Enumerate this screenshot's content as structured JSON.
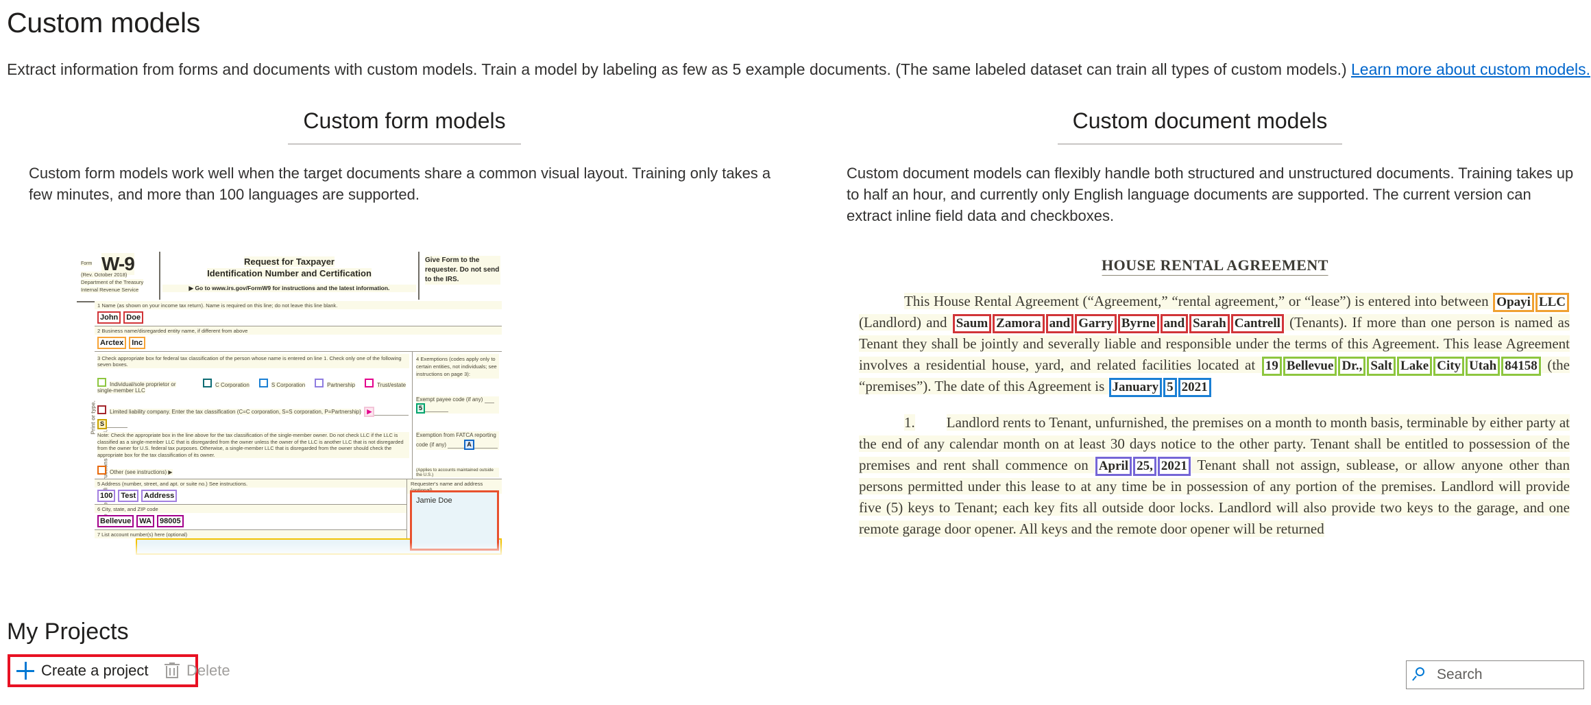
{
  "header": {
    "title": "Custom models",
    "description_before_link": "Extract information from forms and documents with custom models. Train a model by labeling as few as 5 example documents. (The same labeled dataset can train all types of custom models.) ",
    "link_text": "Learn more about custom models."
  },
  "columns": [
    {
      "heading": "Custom form models",
      "body": "Custom form models work well when the target documents share a common visual layout. Training only takes a few minutes, and more than 100 languages are supported."
    },
    {
      "heading": "Custom document models",
      "body": "Custom document models can flexibly handle both structured and unstructured documents. Training takes up to half an hour, and currently only English language documents are supported. The current version can extract inline field data and checkboxes."
    }
  ],
  "w9_form": {
    "form_label": "Form",
    "form_number": "W-9",
    "revision": "(Rev. October 2018)",
    "department": "Department of the Treasury",
    "agency": "Internal Revenue Service",
    "title_line1": "Request for Taxpayer",
    "title_line2": "Identification Number and Certification",
    "goto_line": "▶ Go to www.irs.gov/FormW9 for instructions and the latest information.",
    "give_form": "Give Form to the requester. Do not send to the IRS.",
    "rail_text_1": "Print or type.",
    "rail_text_2": "See Specific Instructions on page 3.",
    "line1_label": "1  Name (as shown on your income tax return). Name is required on this line; do not leave this line blank.",
    "line1_tokens": [
      "John",
      "Doe"
    ],
    "line2_label": "2  Business name/disregarded entity name, if different from above",
    "line2_tokens": [
      "Arctex",
      "Inc"
    ],
    "line3_label": "3  Check appropriate box for federal tax classification of the person whose name is entered on line 1. Check only one of the following seven boxes.",
    "checkboxes": [
      "Individual/sole proprietor or single-member LLC",
      "C Corporation",
      "S Corporation",
      "Partnership",
      "Trust/estate"
    ],
    "llc_line": "Limited liability company. Enter the tax classification (C=C corporation, S=S corporation, P=Partnership)",
    "llc_value": "S",
    "note_text": "Note: Check the appropriate box in the line above for the tax classification of the single-member owner.  Do not check LLC if the LLC is classified as a single-member LLC that is disregarded from the owner unless the owner of the LLC is another LLC that is not disregarded from the owner for U.S. federal tax purposes. Otherwise, a single-member LLC that is disregarded from the owner should check the appropriate box for the tax classification of its owner.",
    "other_line": "Other (see instructions) ▶",
    "line4_label": "4  Exemptions (codes apply only to certain entities, not individuals; see instructions on page 3):",
    "exempt_payee_label": "Exempt payee code (if any)",
    "exempt_payee_value": "5",
    "fatca_label": "Exemption from FATCA reporting code (if any)",
    "fatca_value": "A",
    "applies_note": "(Applies to accounts maintained outside the U.S.)",
    "line5_label": "5  Address (number, street, and apt. or suite no.) See instructions.",
    "line5_tokens": [
      "100",
      "Test",
      "Address"
    ],
    "line6_label": "6  City, state, and ZIP code",
    "line6_tokens": [
      "Bellevue",
      "WA",
      "98005"
    ],
    "line7_label": "7  List account number(s) here (optional)",
    "requester_label": "Requester's name and address (optional)",
    "requester_value": "Jamie Doe"
  },
  "rental_agreement": {
    "title": "HOUSE RENTAL AGREEMENT",
    "p1_part1": "This House Rental Agreement (“Agreement,” “rental agreement,” or “lease”) is entered into between ",
    "landlord_tokens": [
      "Opayi",
      "LLC"
    ],
    "p1_part2": " (Landlord) and ",
    "tenant_tokens": [
      "Saum",
      "Zamora",
      "and",
      "Garry",
      "Byrne",
      "and",
      "Sarah",
      "Cantrell"
    ],
    "p1_part3": " (Tenants).   If more than one person is named as Tenant they shall be jointly and severally liable and responsible under the terms of this Agreement.  This lease Agreement involves a residential house, yard, and related facilities located at ",
    "address_tokens": [
      "19",
      "Bellevue",
      "Dr.,",
      "Salt",
      "Lake",
      "City",
      "Utah",
      "84158"
    ],
    "p1_part4": " (the “premises”). The date of this Agreement is ",
    "date_tokens": [
      "January",
      "5",
      "2021"
    ],
    "p2_number": "1.",
    "p2_part1": "Landlord rents to Tenant, unfurnished, the premises on a month to month basis, terminable by either party at the end of any calendar month on at least 30 days notice to the other party.  Tenant shall be entitled to possession of the premises and rent shall commence on ",
    "commence_tokens": [
      "April",
      "25,",
      "2021"
    ],
    "p2_part2": "  Tenant shall not assign, sublease, or allow anyone other than persons permitted under this lease to at any time be in possession of any portion of the premises.  Landlord will provide five (5) keys to Tenant; each key fits all outside door locks.  Landlord will also provide two keys to the garage, and one remote garage door opener.  All keys and the remote door opener will be returned"
  },
  "projects": {
    "section_title": "My Projects",
    "create_label": "Create a project",
    "delete_label": "Delete",
    "search_placeholder": "Search",
    "search_value": ""
  }
}
